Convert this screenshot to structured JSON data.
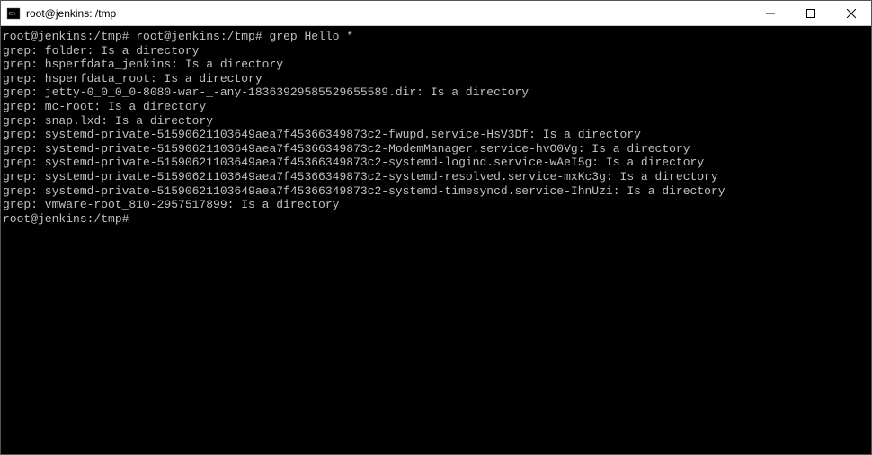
{
  "titlebar": {
    "title": "root@jenkins: /tmp"
  },
  "terminal": {
    "lines": [
      "root@jenkins:/tmp# root@jenkins:/tmp# grep Hello *",
      "grep: folder: Is a directory",
      "grep: hsperfdata_jenkins: Is a directory",
      "grep: hsperfdata_root: Is a directory",
      "grep: jetty-0_0_0_0-8080-war-_-any-18363929585529655589.dir: Is a directory",
      "grep: mc-root: Is a directory",
      "grep: snap.lxd: Is a directory",
      "grep: systemd-private-51590621103649aea7f45366349873c2-fwupd.service-HsV3Df: Is a directory",
      "grep: systemd-private-51590621103649aea7f45366349873c2-ModemManager.service-hvO0Vg: Is a directory",
      "grep: systemd-private-51590621103649aea7f45366349873c2-systemd-logind.service-wAeI5g: Is a directory",
      "grep: systemd-private-51590621103649aea7f45366349873c2-systemd-resolved.service-mxKc3g: Is a directory",
      "grep: systemd-private-51590621103649aea7f45366349873c2-systemd-timesyncd.service-IhnUzi: Is a directory",
      "grep: vmware-root_810-2957517899: Is a directory",
      "root@jenkins:/tmp#"
    ]
  }
}
